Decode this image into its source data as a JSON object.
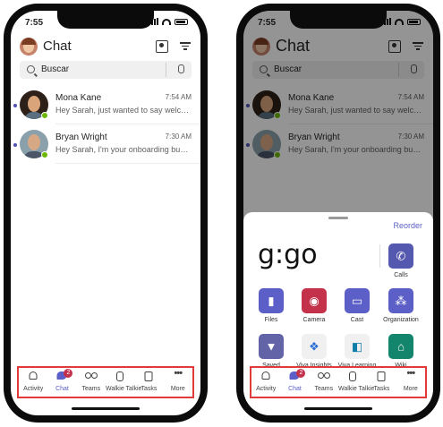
{
  "status": {
    "time": "7:55"
  },
  "header": {
    "title": "Chat"
  },
  "search": {
    "placeholder": "Buscar"
  },
  "chats": [
    {
      "name": "Mona Kane",
      "time": "7:54 AM",
      "preview": "Hey Sarah, just wanted to say welcom..."
    },
    {
      "name": "Bryan Wright",
      "time": "7:30 AM",
      "preview": "Hey Sarah, I'm your onboarding buddy!"
    }
  ],
  "tabs": [
    {
      "label": "Activity",
      "icon": "bell-icon"
    },
    {
      "label": "Chat",
      "icon": "chat-icon",
      "badge": "2"
    },
    {
      "label": "Teams",
      "icon": "teams-icon"
    },
    {
      "label": "Walkie Talkie",
      "icon": "walkie-talkie-icon"
    },
    {
      "label": "Tasks",
      "icon": "tasks-icon"
    },
    {
      "label": "More",
      "icon": "more-icon"
    }
  ],
  "sheet": {
    "reorder_label": "Reorder",
    "handwriting": "g:go",
    "apps": [
      {
        "label": "Calls",
        "icon": "phone-icon",
        "color": "#5558af"
      },
      {
        "label": "Files",
        "icon": "file-icon",
        "color": "#5b5fc7"
      },
      {
        "label": "Camera",
        "icon": "camera-icon",
        "color": "#c4314b"
      },
      {
        "label": "Cast",
        "icon": "cast-icon",
        "color": "#5b5fc7"
      },
      {
        "label": "Organization",
        "icon": "org-chart-icon",
        "color": "#5b5fc7"
      },
      {
        "label": "Saved",
        "icon": "bookmark-icon",
        "color": "#6264a7"
      },
      {
        "label": "Viva Insights",
        "icon": "viva-insights-icon",
        "color": "#f0f0f0"
      },
      {
        "label": "Viva Learning",
        "icon": "viva-learning-icon",
        "color": "#f0f0f0"
      },
      {
        "label": "Wiki",
        "icon": "wiki-icon",
        "color": "#13856d"
      }
    ]
  },
  "colors": {
    "accent": "#5b5fc7",
    "highlight_border": "#e03a3a",
    "presence": "#6bb700"
  }
}
